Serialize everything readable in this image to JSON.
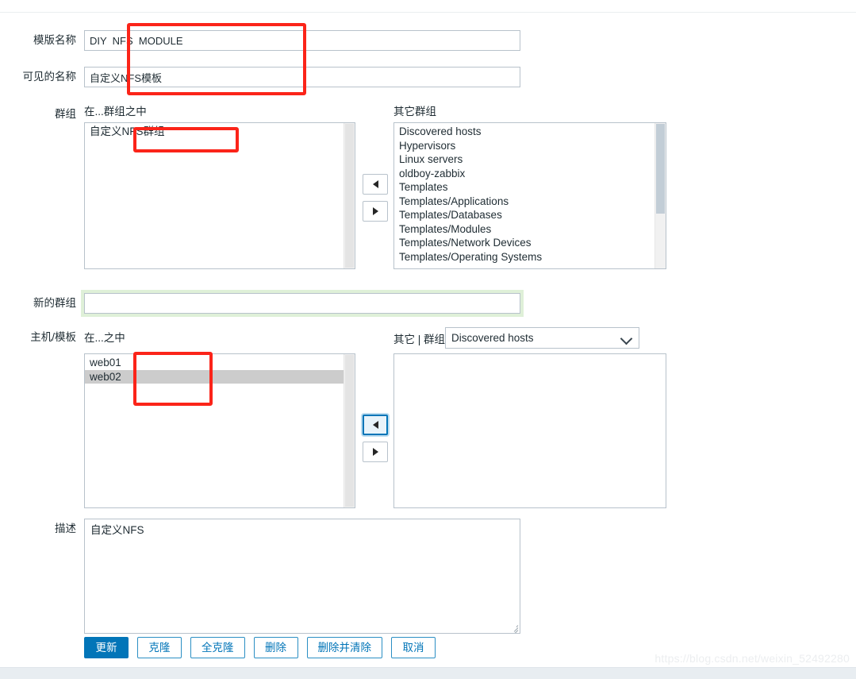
{
  "form": {
    "template_name": {
      "label": "模版名称",
      "value": "DIY  NFS  MODULE",
      "placeholder": ""
    },
    "visible_name": {
      "label": "可见的名称",
      "value": "自定义NFS模板",
      "placeholder": ""
    },
    "groups": {
      "label": "群组",
      "in_groups_label": "在...群组之中",
      "other_groups_label": "其它群组",
      "in_groups": [
        "自定义NFS群组"
      ],
      "other_groups": [
        "Discovered hosts",
        "Hypervisors",
        "Linux servers",
        "oldboy-zabbix",
        "Templates",
        "Templates/Applications",
        "Templates/Databases",
        "Templates/Modules",
        "Templates/Network Devices",
        "Templates/Operating Systems"
      ],
      "move_left_icon": "triangle-left-icon",
      "move_right_icon": "triangle-right-icon"
    },
    "new_group": {
      "label": "新的群组",
      "value": "",
      "placeholder": ""
    },
    "hosts_templates": {
      "label": "主机/模板",
      "in_label": "在...之中",
      "other_label": "其它 | 群组",
      "in_hosts": [
        "web01",
        "web02"
      ],
      "selected_host": "web02",
      "other_hosts": [],
      "group_select_value": "Discovered hosts",
      "group_select_options": [
        "Discovered hosts"
      ],
      "move_left_icon": "triangle-left-icon",
      "move_right_icon": "triangle-right-icon"
    },
    "description": {
      "label": "描述",
      "value": "自定义NFS",
      "placeholder": ""
    }
  },
  "actions": {
    "update": "更新",
    "clone": "克隆",
    "full_clone": "全克隆",
    "delete": "删除",
    "delete_and_clear": "删除并清除",
    "cancel": "取消"
  },
  "watermark": "https://blog.csdn.net/weixin_52492280",
  "colors": {
    "accent": "#0275b8",
    "annotation": "#fb2419",
    "field_border": "#b8c2cb",
    "selected_row": "#cccccc",
    "valid_glow": "#dff0d8"
  }
}
